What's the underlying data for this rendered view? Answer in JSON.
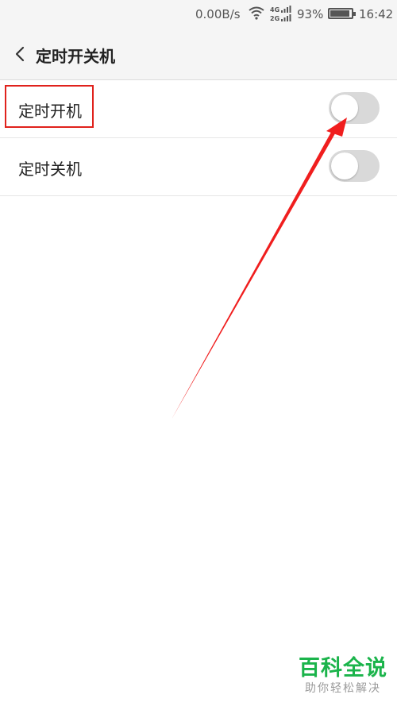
{
  "status_bar": {
    "network_speed": "0.00B/s",
    "signal_badges": [
      "4G",
      "2G"
    ],
    "battery_percent": "93%",
    "battery_level": 0.93,
    "time": "16:42",
    "icons": [
      "wifi-icon",
      "cellular-signal-icon",
      "battery-icon"
    ]
  },
  "header": {
    "back_icon": "chevron-left-icon",
    "title": "定时开关机"
  },
  "settings": [
    {
      "label": "定时开机",
      "enabled": false
    },
    {
      "label": "定时关机",
      "enabled": false
    }
  ],
  "annotation": {
    "highlight_color": "#e0221c",
    "arrow_color": "#f01e1e"
  },
  "watermark": {
    "brand": "百科全说",
    "slogan": "助你轻松解决",
    "brand_color": "#1bb44b"
  }
}
